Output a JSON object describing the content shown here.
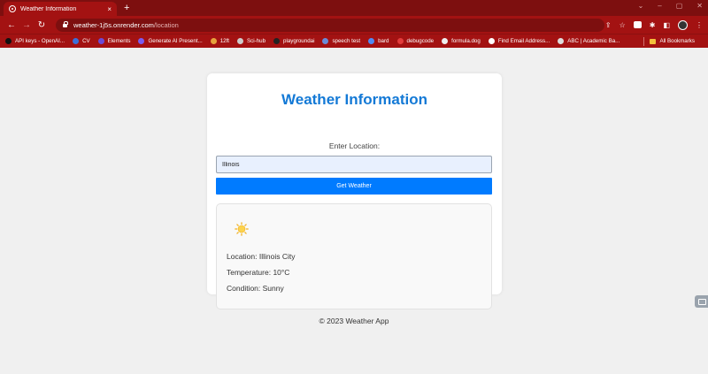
{
  "browser": {
    "tab_title": "Weather Information",
    "tab_close": "×",
    "new_tab": "+",
    "url_host": "weather-1j5s.onrender.com",
    "url_path": "/location",
    "bookmarks": [
      {
        "label": "API keys - OpenAI...",
        "color": "#111111"
      },
      {
        "label": "CV",
        "color": "#3b6fd9"
      },
      {
        "label": "Elements",
        "color": "#6b4ad6"
      },
      {
        "label": "Generate AI Present...",
        "color": "#7a5cf0"
      },
      {
        "label": "12ft",
        "color": "#e6a23c"
      },
      {
        "label": "Sci-hub",
        "color": "#cccccc"
      },
      {
        "label": "playgroundai",
        "color": "#222222"
      },
      {
        "label": "speech test",
        "color": "#6a8bd8"
      },
      {
        "label": "bard",
        "color": "#4f8bf5"
      },
      {
        "label": "debugcode",
        "color": "#e23c3c"
      },
      {
        "label": "formula.dog",
        "color": "#eeeeee"
      },
      {
        "label": "Find Email Address...",
        "color": "#ffffff"
      },
      {
        "label": "ABC | Academic Ba...",
        "color": "#dddddd"
      }
    ],
    "all_bookmarks": "All Bookmarks"
  },
  "app": {
    "title": "Weather Information",
    "location_label": "Enter Location:",
    "location_value": "Illinois",
    "button_label": "Get Weather",
    "result": {
      "location": "Location: Illinois City",
      "temperature": "Temperature: 10°C",
      "condition": "Condition: Sunny",
      "icon": "sun-icon"
    },
    "footer": "© 2023 Weather App"
  },
  "colors": {
    "chrome_dark": "#7d0f0f",
    "chrome": "#a31212",
    "title_blue": "#1379d6",
    "button_blue": "#007bff"
  }
}
